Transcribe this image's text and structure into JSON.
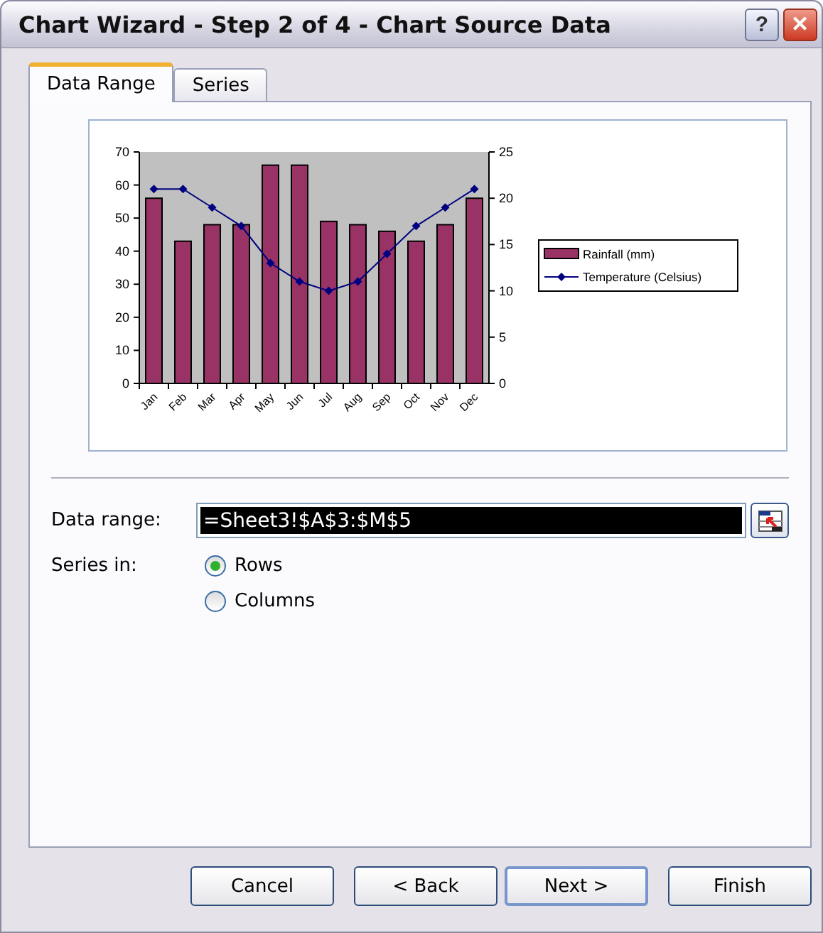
{
  "window": {
    "title": "Chart Wizard - Step 2 of 4 - Chart Source Data",
    "help": "?",
    "close": "✕"
  },
  "tabs": [
    {
      "label": "Data Range",
      "selected": true
    },
    {
      "label": "Series",
      "selected": false
    }
  ],
  "chart": {
    "chart_data": {
      "type": "bar",
      "categories": [
        "Jan",
        "Feb",
        "Mar",
        "Apr",
        "May",
        "Jun",
        "Jul",
        "Aug",
        "Sep",
        "Oct",
        "Nov",
        "Dec"
      ],
      "series": [
        {
          "name": "Rainfall (mm)",
          "color": "#993366",
          "axis": "y",
          "values": [
            56,
            43,
            48,
            48,
            66,
            66,
            49,
            48,
            46,
            43,
            48,
            56
          ]
        },
        {
          "name": "Temperature (Celsius)",
          "color": "#000080",
          "type": "line",
          "axis": "y2",
          "marker": "diamond",
          "values": [
            21,
            21,
            19,
            17,
            13,
            11,
            10,
            11,
            14,
            17,
            19,
            21
          ]
        }
      ],
      "legend": "right",
      "ylim": [
        0,
        70
      ],
      "yticks": [
        0,
        10,
        20,
        30,
        40,
        50,
        60,
        70
      ],
      "y2lim": [
        0,
        25
      ],
      "y2ticks": [
        0,
        5,
        10,
        15,
        20,
        25
      ]
    }
  },
  "data_range": {
    "label": "Data range:",
    "value": "=Sheet3!$A$3:$M$5"
  },
  "series_in": {
    "label": "Series in:",
    "options": [
      {
        "label": "Rows",
        "selected": true
      },
      {
        "label": "Columns",
        "selected": false
      }
    ]
  },
  "buttons": [
    {
      "label": "Cancel",
      "default": false
    },
    {
      "label": "< Back",
      "default": false
    },
    {
      "label": "Next >",
      "default": true
    },
    {
      "label": "Finish",
      "default": false
    }
  ]
}
